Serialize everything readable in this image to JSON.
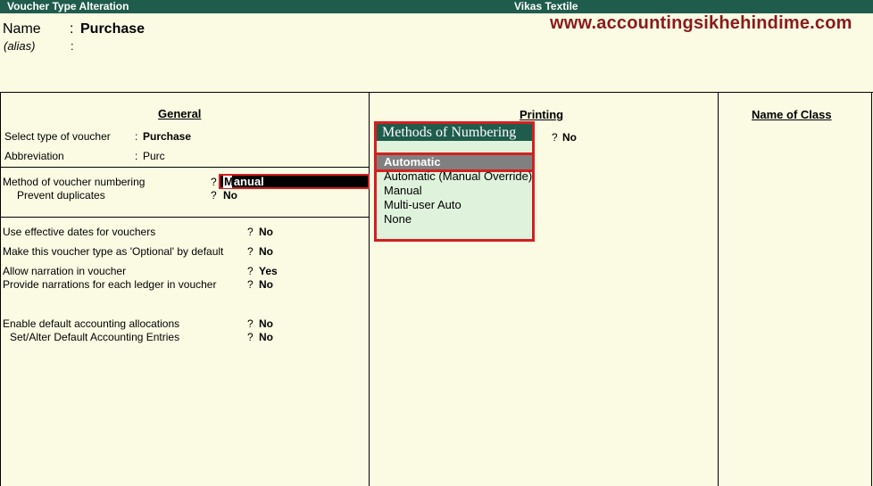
{
  "titlebar": {
    "screen_title": "Voucher Type Alteration",
    "company": "Vikas Textile"
  },
  "header": {
    "name_label": "Name",
    "name_colon": ":",
    "name_value": "Purchase",
    "alias_label": "(alias)",
    "alias_colon": ":",
    "website": "www.accountingsikhehindime.com"
  },
  "general": {
    "title": "General",
    "select_type_label": "Select type of voucher",
    "select_type_colon": ":",
    "select_type_value": "Purchase",
    "abbreviation_label": "Abbreviation",
    "abbreviation_colon": ":",
    "abbreviation_value": "Purc",
    "numbering_label": "Method of voucher numbering",
    "numbering_q": "?",
    "numbering_value": "Manual",
    "numbering_first_char": "M",
    "prevent_dup_label": "Prevent duplicates",
    "prevent_dup_q": "?",
    "prevent_dup_value": "No",
    "effective_dates_label": "Use effective dates for vouchers",
    "effective_dates_q": "?",
    "effective_dates_value": "No",
    "optional_label": "Make this voucher type as 'Optional' by default",
    "optional_q": "?",
    "optional_value": "No",
    "narration_label": "Allow narration in voucher",
    "narration_q": "?",
    "narration_value": "Yes",
    "narration_each_label": "Provide narrations for each ledger in voucher",
    "narration_each_q": "?",
    "narration_each_value": "No",
    "default_alloc_label": "Enable default accounting allocations",
    "default_alloc_q": "?",
    "default_alloc_value": "No",
    "alter_entries_label": "Set/Alter Default Accounting Entries",
    "alter_entries_q": "?",
    "alter_entries_value": "No"
  },
  "printing": {
    "title": "Printing",
    "hidden_field_q": "?",
    "hidden_field_value": "No"
  },
  "class": {
    "title": "Name of Class"
  },
  "popup": {
    "title": "Methods of Numbering",
    "selected": "Automatic",
    "items": [
      "Automatic (Manual Override)",
      "Manual",
      "Multi-user Auto",
      "None"
    ]
  },
  "colors": {
    "titlebar_bg": "#1f5c4c",
    "page_bg": "#fbfbe4",
    "highlight_border": "#d42020",
    "popup_bg": "#dff3dc",
    "website_color": "#8b1a1a"
  }
}
